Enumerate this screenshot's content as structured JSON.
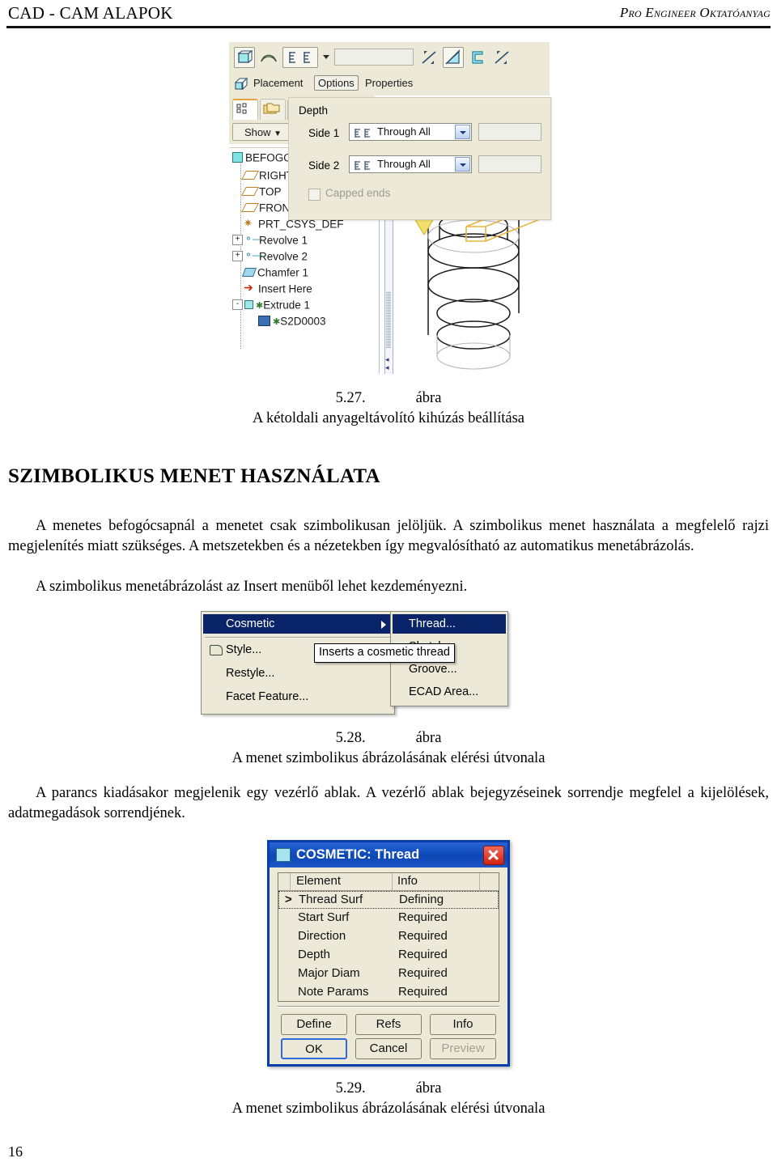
{
  "header": {
    "left": "CAD - CAM ALAPOK",
    "right": "Pro Engineer Oktatóanyag"
  },
  "page_number": "16",
  "section": {
    "title": "SZIMBOLIKUS MENET HASZNÁLATA"
  },
  "paragraphs": {
    "p1": "A menetes befogócsapnál a menetet csak szimbolikusan jelöljük. A szimbolikus menet használata a megfelelő rajzi megjelenítés miatt szükséges. A metszetekben és a nézetekben így megvalósítható az automatikus menetábrázolás.",
    "p2": "A szimbolikus menetábrázolást az Insert menüből lehet kezdeményezni.",
    "p3": "A parancs kiadásakor megjelenik egy vezérlő ablak. A vezérlő ablak bejegyzéseinek sorrendje megfelel a kijelölések, adatmegadások sorrendjének."
  },
  "captions": {
    "fig527_num": "5.27.",
    "fig527_word": "ábra",
    "fig527_text": "A kétoldali anyageltávolító kihúzás beállítása",
    "fig528_num": "5.28.",
    "fig528_word": "ábra",
    "fig528_text": "A menet szimbolikus ábrázolásának elérési útvonala",
    "fig529_num": "5.29.",
    "fig529_word": "ábra",
    "fig529_text": "A menet szimbolikus ábrázolásának elérési útvonala"
  },
  "figure527": {
    "dashboard_tabs": [
      {
        "label": "Placement",
        "active": false
      },
      {
        "label": "Options",
        "active": true
      },
      {
        "label": "Properties",
        "active": false
      }
    ],
    "show_button": "Show",
    "settings_button": "S",
    "panel": {
      "group_label": "Depth",
      "side1_label": "Side 1",
      "side1_value": "Through All",
      "side2_label": "Side 2",
      "side2_value": "Through All",
      "capped_ends_label": "Capped ends"
    },
    "model_tree": [
      {
        "label": "BEFOGOCS.I",
        "icon": "part-icon",
        "depth": 0,
        "expander": ""
      },
      {
        "label": "RIGHT",
        "icon": "datum-plane-icon",
        "depth": 1,
        "expander": ""
      },
      {
        "label": "TOP",
        "icon": "datum-plane-icon",
        "depth": 1,
        "expander": ""
      },
      {
        "label": "FRONT",
        "icon": "datum-plane-icon",
        "depth": 1,
        "expander": ""
      },
      {
        "label": "PRT_CSYS_DEF",
        "icon": "coordinate-system-icon",
        "depth": 1,
        "expander": ""
      },
      {
        "label": "Revolve 1",
        "icon": "revolve-icon",
        "depth": 1,
        "expander": "+"
      },
      {
        "label": "Revolve 2",
        "icon": "revolve-icon",
        "depth": 1,
        "expander": "+"
      },
      {
        "label": "Chamfer 1",
        "icon": "chamfer-icon",
        "depth": 1,
        "expander": ""
      },
      {
        "label": "Insert Here",
        "icon": "insert-here-icon",
        "depth": 1,
        "expander": ""
      },
      {
        "label": "Extrude 1",
        "icon": "extrude-icon",
        "depth": 1,
        "expander": "-"
      },
      {
        "label": "S2D0003",
        "icon": "sketch-icon",
        "depth": 2,
        "expander": ""
      }
    ]
  },
  "figure528": {
    "main_menu": [
      {
        "label": "Cosmetic",
        "accel": "e",
        "selected": true,
        "submenu": true
      },
      {
        "label": "Style...",
        "accel": "y",
        "selected": false,
        "icon": "style-icon"
      },
      {
        "label": "Restyle...",
        "accel": "R",
        "selected": false
      },
      {
        "label": "Facet Feature...",
        "accel": "F",
        "selected": false
      }
    ],
    "submenu": [
      {
        "label": "Thread...",
        "accel": "T",
        "selected": true
      },
      {
        "label": "Sketch...",
        "accel": "k",
        "selected": false
      },
      {
        "label": "Groove...",
        "accel": "G",
        "selected": false
      },
      {
        "label": "ECAD Area...",
        "accel": "E",
        "selected": false
      }
    ],
    "tooltip": "Inserts a cosmetic thread"
  },
  "figure529": {
    "title": "COSMETIC: Thread",
    "columns": [
      "Element",
      "Info"
    ],
    "rows": [
      {
        "element": "Thread Surf",
        "info": "Defining",
        "active": true,
        "marker": ">"
      },
      {
        "element": "Start Surf",
        "info": "Required",
        "active": false,
        "marker": ""
      },
      {
        "element": "Direction",
        "info": "Required",
        "active": false,
        "marker": ""
      },
      {
        "element": "Depth",
        "info": "Required",
        "active": false,
        "marker": ""
      },
      {
        "element": "Major Diam",
        "info": "Required",
        "active": false,
        "marker": ""
      },
      {
        "element": "Note Params",
        "info": "Required",
        "active": false,
        "marker": ""
      }
    ],
    "buttons": [
      {
        "label": "Define",
        "state": "normal"
      },
      {
        "label": "Refs",
        "state": "normal"
      },
      {
        "label": "Info",
        "state": "normal"
      },
      {
        "label": "OK",
        "state": "focused"
      },
      {
        "label": "Cancel",
        "state": "normal"
      },
      {
        "label": "Preview",
        "state": "disabled"
      }
    ]
  },
  "colors": {
    "menu_highlight": "#0a246a",
    "dialog_border": "#0b3fa8",
    "titlebar": "#0b47b5",
    "close_button": "#cf2313",
    "toolbar_bg": "#ece9d8",
    "accent_orange": "#e8a33d"
  }
}
